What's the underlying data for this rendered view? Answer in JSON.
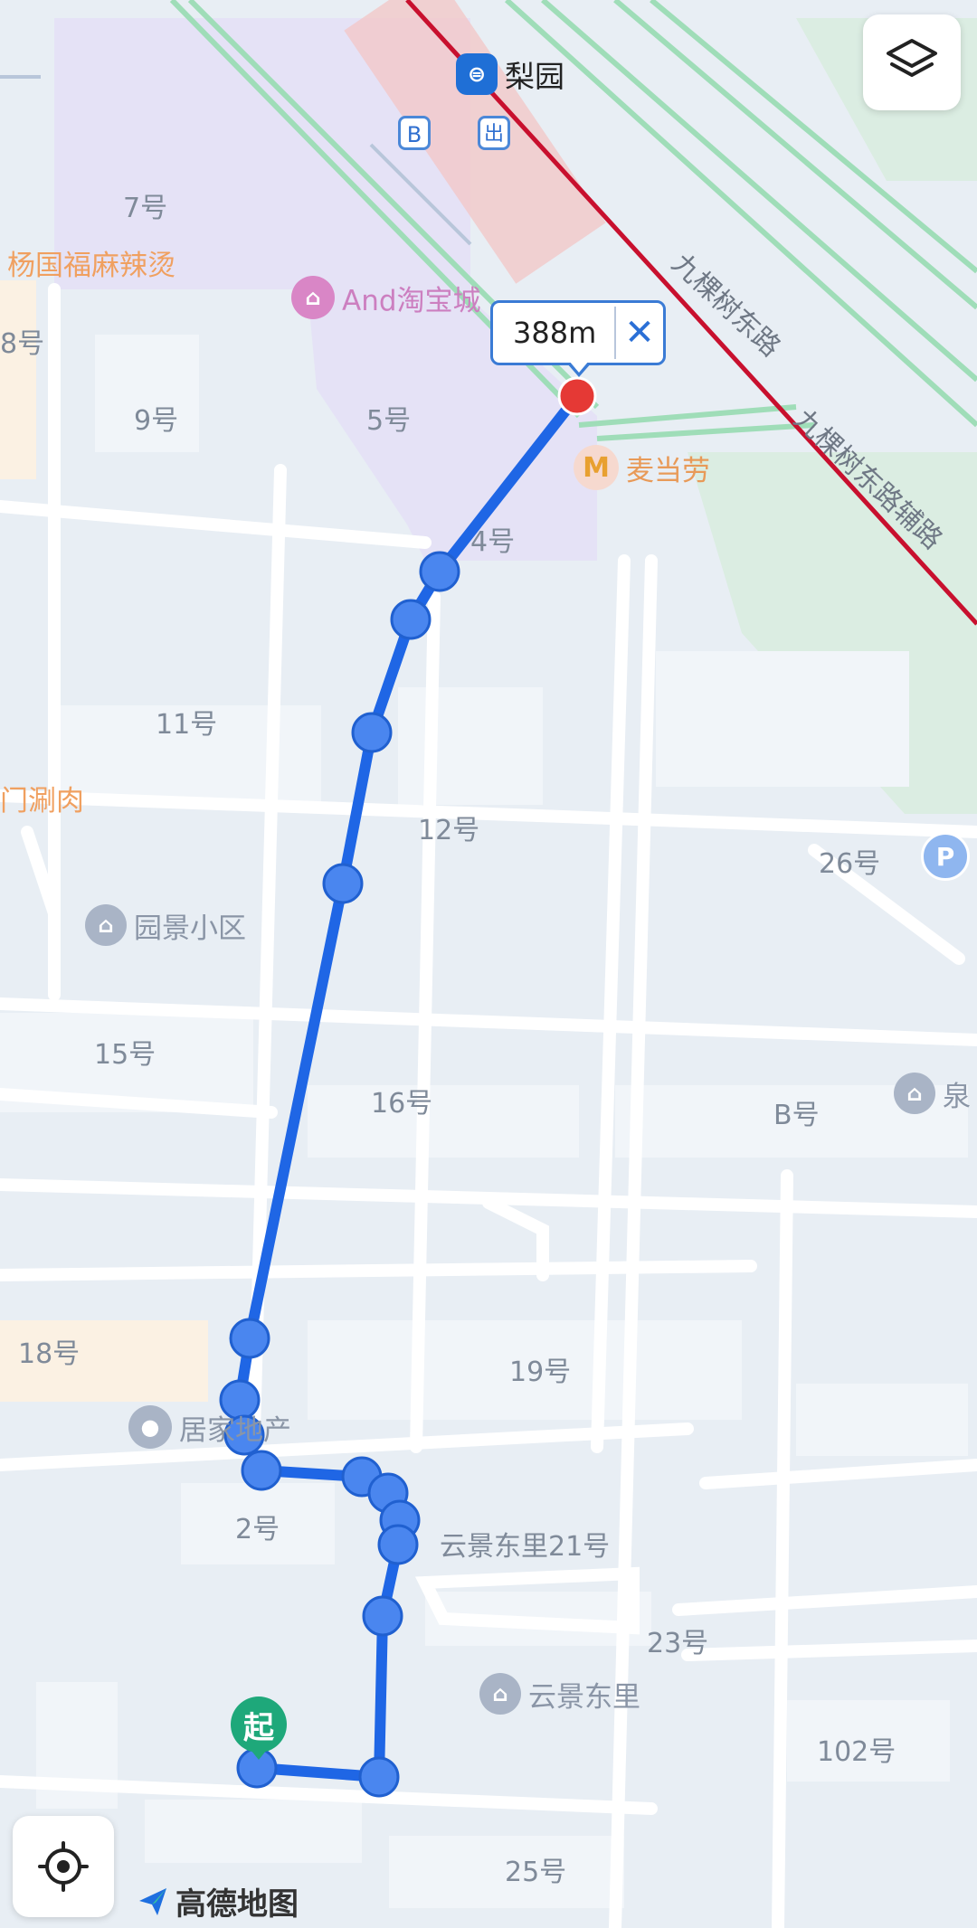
{
  "map": {
    "station": {
      "name": "梨园",
      "exit_b": "B",
      "exit_out": "出"
    },
    "roads": [
      "九棵树东路",
      "九棵树东路辅路"
    ],
    "labels": {
      "n7": "7号",
      "n8": "8号",
      "n9": "9号",
      "n5": "5号",
      "n4": "4号",
      "n11": "11号",
      "n12": "12号",
      "n26": "26号",
      "n15": "15号",
      "n16": "16号",
      "nB": "B号",
      "n18": "18号",
      "n19": "19号",
      "n2": "2号",
      "yunjing21": "云景东里21号",
      "n23": "23号",
      "n102": "102号",
      "n25": "25号"
    },
    "pois": {
      "malatang": "杨国福麻辣烫",
      "taobao": "And淘宝城",
      "mcd": "麦当劳",
      "shuanrou": "门涮肉",
      "yuanjing": "园景小区",
      "quan": "泉",
      "jujia": "居家地产",
      "yunjing": "云景东里"
    },
    "parking": "P"
  },
  "route": {
    "distance": "388m",
    "close_icon": "close-icon",
    "start_label": "起",
    "route_color": "#1f66e5",
    "waypoint_color": "#4a86ef",
    "end_color": "#e53935"
  },
  "controls": {
    "layers": "layers-icon",
    "locate": "locate-icon"
  },
  "brand": {
    "name": "高德地图"
  }
}
